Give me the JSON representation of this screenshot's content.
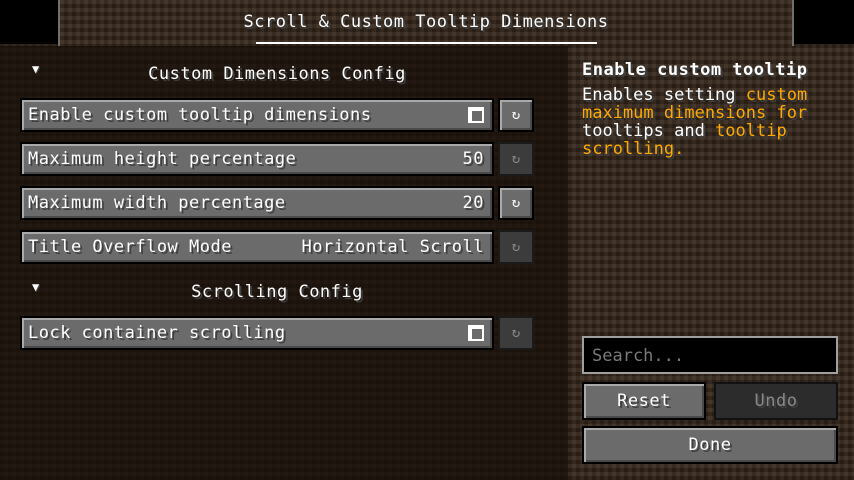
{
  "window": {
    "title": "Scroll & Custom Tooltip Dimensions"
  },
  "sections": [
    {
      "title": "Custom Dimensions Config",
      "arrow_icon": "triangle-down-icon",
      "options": [
        {
          "name": "Enable custom tooltip dimensions",
          "type": "checkbox",
          "checked": true,
          "reset_enabled": true
        },
        {
          "name": "Maximum height percentage",
          "type": "value",
          "value": "50",
          "reset_enabled": false
        },
        {
          "name": "Maximum width percentage",
          "type": "value",
          "value": "20",
          "reset_enabled": true
        },
        {
          "name": "Title Overflow Mode",
          "type": "value",
          "value": "Horizontal Scroll",
          "reset_enabled": false
        }
      ]
    },
    {
      "title": "Scrolling Config",
      "arrow_icon": "triangle-down-icon",
      "options": [
        {
          "name": "Lock container scrolling",
          "type": "checkbox",
          "checked": true,
          "reset_enabled": false
        }
      ]
    }
  ],
  "tooltip": {
    "title": "Enable custom tooltip",
    "desc_parts": [
      {
        "text": "Enables setting ",
        "highlight": false
      },
      {
        "text": "custom maximum dimensions for",
        "highlight": true
      },
      {
        "text": " tooltips and ",
        "highlight": false
      },
      {
        "text": "tooltip scrolling.",
        "highlight": true
      }
    ]
  },
  "search": {
    "placeholder": "Search...",
    "value": ""
  },
  "buttons": {
    "reset": "Reset",
    "undo": "Undo",
    "done": "Done"
  },
  "reset_icon": "↻",
  "colors": {
    "highlight": "#ffaa00",
    "title": "#ffffff"
  }
}
